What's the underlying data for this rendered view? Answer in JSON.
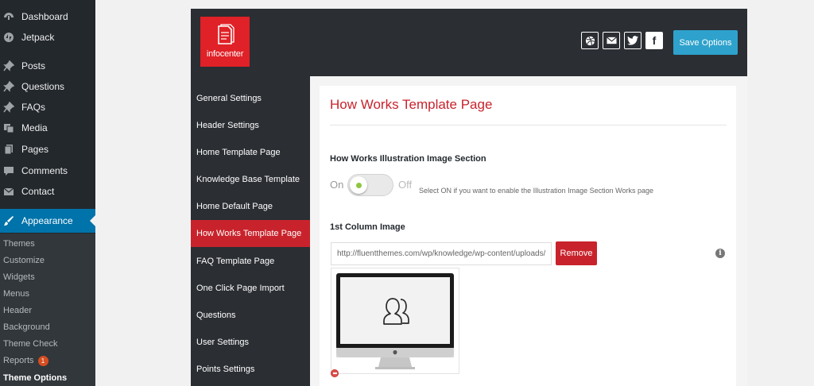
{
  "wp_menu": {
    "items": [
      {
        "label": "Dashboard",
        "icon": "dashboard-icon"
      },
      {
        "label": "Jetpack",
        "icon": "jetpack-icon"
      },
      {
        "label": "Posts",
        "icon": "pin-icon"
      },
      {
        "label": "Questions",
        "icon": "pin-icon"
      },
      {
        "label": "FAQs",
        "icon": "pin-icon"
      },
      {
        "label": "Media",
        "icon": "media-icon"
      },
      {
        "label": "Pages",
        "icon": "pages-icon"
      },
      {
        "label": "Comments",
        "icon": "comment-icon"
      },
      {
        "label": "Contact",
        "icon": "mail-icon"
      },
      {
        "label": "Appearance",
        "icon": "brush-icon"
      }
    ],
    "submenu": [
      {
        "label": "Themes"
      },
      {
        "label": "Customize"
      },
      {
        "label": "Widgets"
      },
      {
        "label": "Menus"
      },
      {
        "label": "Header"
      },
      {
        "label": "Background"
      },
      {
        "label": "Theme Check"
      },
      {
        "label": "Reports",
        "badge": "1"
      },
      {
        "label": "Theme Options"
      }
    ]
  },
  "header": {
    "logo_text": "infocenter",
    "save_label": "Save Options",
    "social_icons": [
      "dribbble-icon",
      "email-icon",
      "twitter-icon",
      "facebook-icon"
    ],
    "facebook_glyph": "f"
  },
  "nav": {
    "items": [
      {
        "label": "General Settings"
      },
      {
        "label": "Header Settings"
      },
      {
        "label": "Home Template Page"
      },
      {
        "label": "Knowledge Base Template"
      },
      {
        "label": "Home Default Page"
      },
      {
        "label": "How Works Template Page"
      },
      {
        "label": "FAQ Template Page"
      },
      {
        "label": "One Click Page Import"
      },
      {
        "label": "Questions"
      },
      {
        "label": "User Settings"
      },
      {
        "label": "Points Settings"
      }
    ]
  },
  "content": {
    "title": "How Works Template Page",
    "section_title": "How Works Illustration Image Section",
    "toggle_on": "On",
    "toggle_off": "Off",
    "toggle_help": "Select ON if you want to enable the Illustration Image Section Works page",
    "column_title": "1st Column Image",
    "image_url": "http://fluentthemes.com/wp/knowledge/wp-content/uploads/2",
    "remove_label": "Remove",
    "info_glyph": "i"
  },
  "colors": {
    "accent_red": "#c8232c",
    "save_blue": "#2ea2cc",
    "wp_active": "#0073aa"
  }
}
